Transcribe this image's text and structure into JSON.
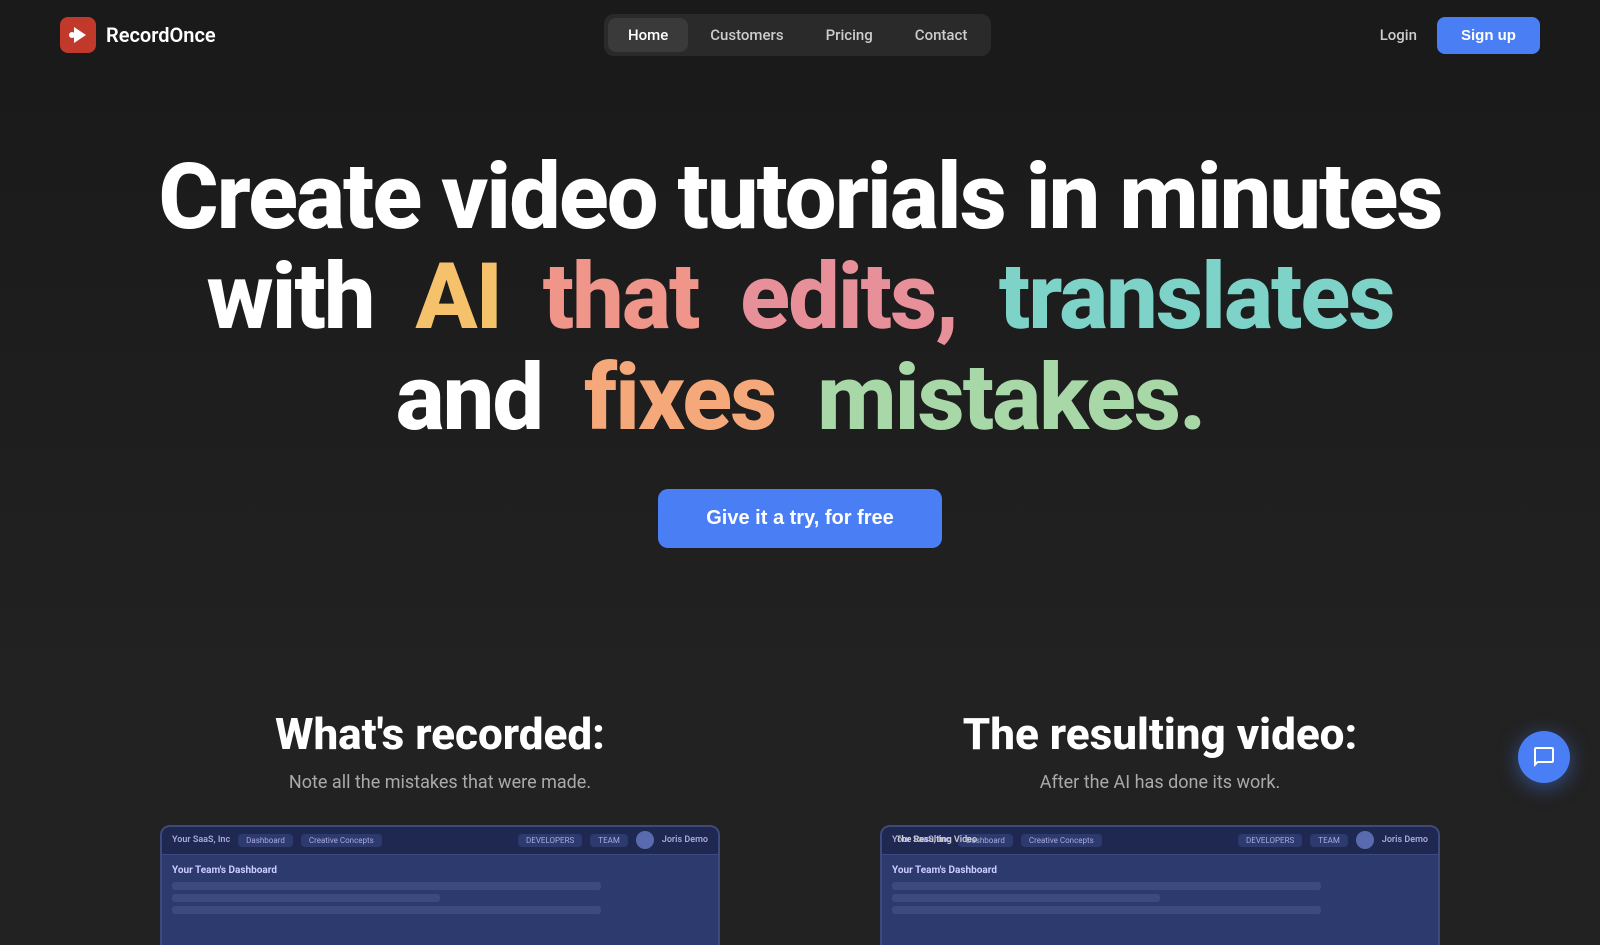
{
  "brand": {
    "name": "RecordOnce"
  },
  "navbar": {
    "links": [
      {
        "label": "Home",
        "active": true
      },
      {
        "label": "Customers",
        "active": false
      },
      {
        "label": "Pricing",
        "active": false
      },
      {
        "label": "Contact",
        "active": false
      }
    ],
    "login_label": "Login",
    "signup_label": "Sign up"
  },
  "hero": {
    "line1": "Create video tutorials in minutes",
    "words": {
      "with": "with",
      "ai": "AI",
      "that": "that",
      "edits": "edits,",
      "translates": "translates",
      "and": "and",
      "fixes": "fixes",
      "mistakes": "mistakes."
    },
    "cta_label": "Give it a try, for free"
  },
  "bottom": {
    "left": {
      "heading": "What's recorded:",
      "sub": "Note all the mistakes that were made."
    },
    "right": {
      "heading": "The resulting video:",
      "sub": "After the AI has done its work.",
      "video_label": "The Resulting Video"
    }
  },
  "preview": {
    "saas_label": "Your SaaS, Inc",
    "dashboard_label": "Dashboard",
    "creative_label": "Creative Concepts",
    "developers_label": "DEVELOPERS",
    "team_label": "TEAM",
    "joris_label": "Joris Demo"
  },
  "chat_icon": "💬"
}
